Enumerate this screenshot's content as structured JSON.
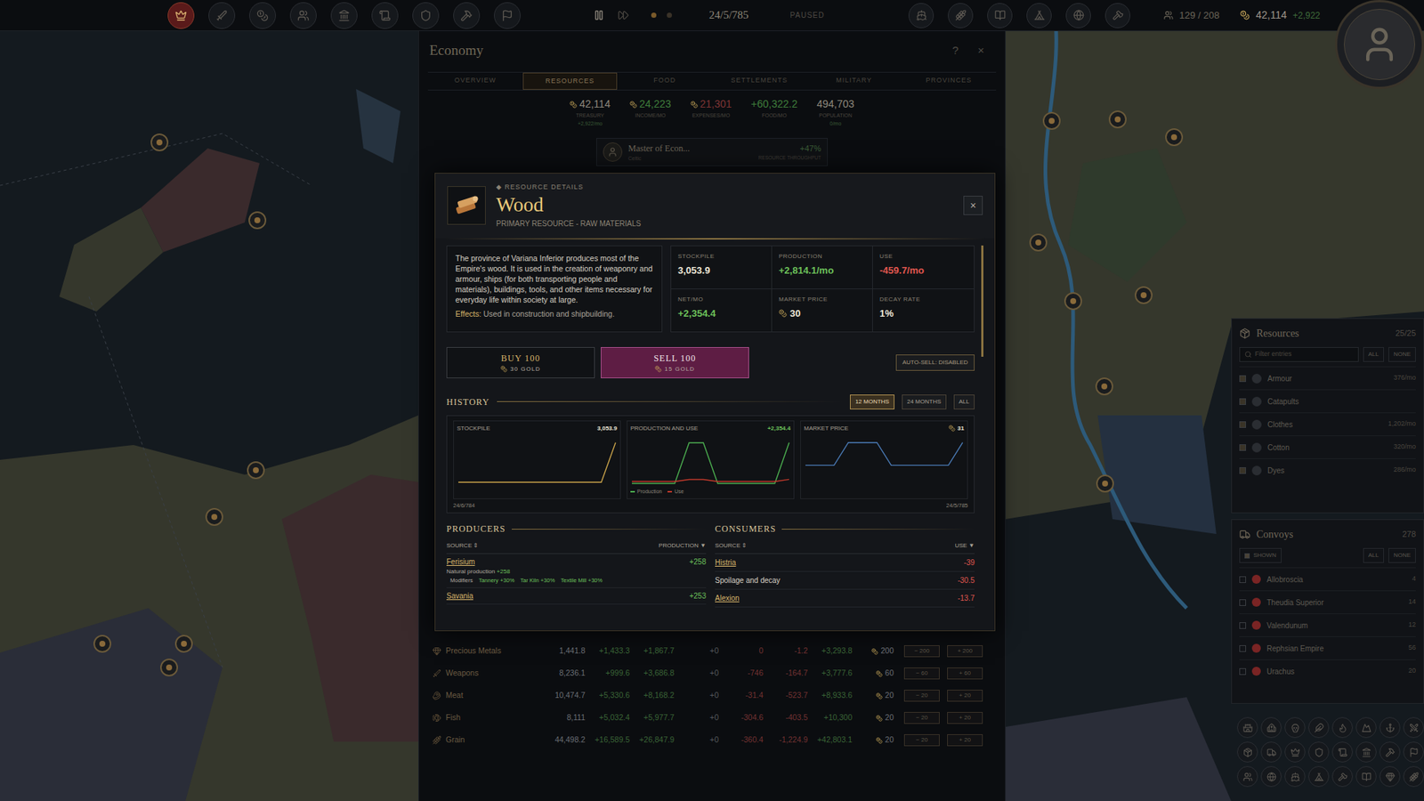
{
  "top_bar": {
    "left_buttons": [
      {
        "selected": true
      },
      {
        "selected": false
      },
      {
        "selected": false
      },
      {
        "selected": false
      },
      {
        "selected": false
      },
      {
        "selected": false
      },
      {
        "selected": false
      },
      {
        "selected": false
      },
      {
        "selected": false
      }
    ],
    "right_buttons": [
      {
        "selected": false
      },
      {
        "selected": false
      },
      {
        "selected": false
      },
      {
        "selected": false
      },
      {
        "selected": false
      },
      {
        "selected": false
      }
    ],
    "paused": true,
    "date": "24/5/785",
    "status": "PAUSED",
    "population": "129 / 208",
    "treasury": "42,114",
    "treasury_change": "+2,922"
  },
  "economy": {
    "title": "Economy",
    "help": "?",
    "close": "×",
    "tabs": [
      {
        "label": "OVERVIEW",
        "selected": false
      },
      {
        "label": "RESOURCES",
        "selected": true
      },
      {
        "label": "FOOD",
        "selected": false
      },
      {
        "label": "SETTLEMENTS",
        "selected": false
      },
      {
        "label": "MILITARY",
        "selected": false
      },
      {
        "label": "PROVINCES",
        "selected": false
      }
    ],
    "stats": [
      {
        "value": "42,114",
        "label": "TREASURY",
        "sub": "+2,922/mo",
        "coin": true,
        "color": "#8d887c"
      },
      {
        "value": "24,223",
        "label": "INCOME/MO",
        "sub": "",
        "coin": true,
        "color": "#3f7d3b"
      },
      {
        "value": "21,301",
        "label": "EXPENSES/MO",
        "sub": "",
        "coin": true,
        "color": "#7d3434"
      },
      {
        "value": "+60,322.2",
        "label": "FOOD/MO",
        "sub": "",
        "coin": false,
        "color": "#3f7d3b"
      },
      {
        "value": "494,703",
        "label": "POPULATION",
        "sub": "0/mo",
        "coin": false,
        "color": "#8d887c"
      }
    ],
    "minister": {
      "name": "Master of Econ...",
      "culture": "Celtic",
      "bonus": "+47%",
      "bonus_label": "RESOURCE THROUGHPUT"
    },
    "rows": [
      {
        "name": "Precious Metals",
        "cells": [
          "1,441.8",
          "+1,433.3",
          "+1,867.7",
          "+0",
          "0",
          "-1.2",
          "+3,293.8",
          "200"
        ],
        "sell": "− 200",
        "buy": "+ 200"
      },
      {
        "name": "Weapons",
        "cells": [
          "8,236.1",
          "+999.6",
          "+3,686.8",
          "+0",
          "-746",
          "-164.7",
          "+3,777.6",
          "60"
        ],
        "sell": "− 60",
        "buy": "+ 60"
      },
      {
        "name": "Meat",
        "cells": [
          "10,474.7",
          "+5,330.6",
          "+8,168.2",
          "+0",
          "-31.4",
          "-523.7",
          "+8,933.6",
          "20"
        ],
        "sell": "− 20",
        "buy": "+ 20"
      },
      {
        "name": "Fish",
        "cells": [
          "8,111",
          "+5,032.4",
          "+5,977.7",
          "+0",
          "-304.6",
          "-403.5",
          "+10,300",
          "20"
        ],
        "sell": "− 20",
        "buy": "+ 20"
      },
      {
        "name": "Grain",
        "cells": [
          "44,498.2",
          "+16,589.5",
          "+26,847.9",
          "+0",
          "-360.4",
          "-1,224.9",
          "+42,803.1",
          "20"
        ],
        "sell": "− 20",
        "buy": "+ 20"
      }
    ]
  },
  "resource": {
    "eyebrow": "◆ RESOURCE DETAILS",
    "name": "Wood",
    "category": "PRIMARY RESOURCE - RAW MATERIALS",
    "close": "×",
    "description": "The province of Variana Inferior produces most of the Empire's wood. It is used in the creation of weaponry and armour, ships (for both transporting people and materials), buildings, tools, and other items necessary for everyday life within society at large.",
    "effects_label": "Effects:",
    "effects": "Used in construction and shipbuilding.",
    "stats": [
      {
        "label": "STOCKPILE",
        "value": "3,053.9",
        "color": "#ece6d8",
        "coin": false
      },
      {
        "label": "PRODUCTION",
        "value": "+2,814.1/mo",
        "color": "#6cc05a",
        "coin": false
      },
      {
        "label": "USE",
        "value": "-459.7/mo",
        "color": "#e0574f",
        "coin": false
      },
      {
        "label": "NET/MO",
        "value": "+2,354.4",
        "color": "#6cc05a",
        "coin": false
      },
      {
        "label": "MARKET PRICE",
        "value": "30",
        "color": "#ece6d8",
        "coin": true
      },
      {
        "label": "DECAY RATE",
        "value": "1%",
        "color": "#ece6d8",
        "coin": false
      }
    ],
    "trade": {
      "buy": {
        "label": "BUY 100",
        "price": "30 GOLD",
        "selected": false
      },
      "sell": {
        "label": "SELL 100",
        "price": "15 GOLD",
        "selected": true
      },
      "auto_sell": {
        "label": "AUTO-SELL: DISABLED",
        "on": false
      }
    },
    "history": {
      "title": "HISTORY",
      "ranges": [
        {
          "label": "12 MONTHS",
          "selected": true
        },
        {
          "label": "24 MONTHS",
          "selected": false
        },
        {
          "label": "ALL",
          "selected": false
        }
      ],
      "start_date": "24/6/784",
      "end_date": "24/5/785",
      "charts": [
        {
          "title": "STOCKPILE",
          "reading": "3,053.9",
          "reading_color": "#ece6d8",
          "coin": false,
          "series": [
            {
              "name": "",
              "color": "#c9a34a",
              "values": [
                300,
                300,
                300,
                300,
                300,
                300,
                300,
                300,
                300,
                300,
                300,
                3053.9
              ]
            }
          ]
        },
        {
          "title": "PRODUCTION AND USE",
          "reading": "+2,354.4",
          "reading_color": "#6cc05a",
          "coin": false,
          "series": [
            {
              "name": "Production",
              "color": "#4caf50",
              "values": [
                200,
                200,
                200,
                200,
                2800,
                2800,
                200,
                200,
                200,
                200,
                200,
                2814.1
              ]
            },
            {
              "name": "Use",
              "color": "#c0392b",
              "values": [
                320,
                320,
                320,
                320,
                450,
                450,
                320,
                320,
                320,
                320,
                320,
                459.7
              ]
            }
          ]
        },
        {
          "title": "MARKET PRICE",
          "reading": "31",
          "reading_color": "#ece6d8",
          "coin": true,
          "series": [
            {
              "name": "",
              "color": "#4a7ab5",
              "values": [
                15,
                15,
                15,
                31,
                31,
                31,
                15,
                15,
                15,
                15,
                15,
                31
              ]
            }
          ]
        }
      ]
    },
    "producers": {
      "title": "PRODUCERS",
      "source_col": "SOURCE",
      "source_sort": "⇕",
      "value_col": "PRODUCTION",
      "value_sort": "▼",
      "rows": [
        {
          "name": "Ferisium",
          "value": "+258",
          "detail_label": "Natural production",
          "detail_value": "+258",
          "modifiers_label": "Modifiers",
          "modifiers": [
            "Tannery +30%",
            "Tar Kiln +30%",
            "Textile Mill +30%"
          ]
        },
        {
          "name": "Savania",
          "value": "+253",
          "detail_label": "",
          "detail_value": "",
          "modifiers_label": "",
          "modifiers": []
        }
      ]
    },
    "consumers": {
      "title": "CONSUMERS",
      "source_col": "SOURCE",
      "source_sort": "⇕",
      "value_col": "USE",
      "value_sort": "▼",
      "rows": [
        {
          "name": "Histria",
          "value": "-39",
          "link": true
        },
        {
          "name": "Spoilage and decay",
          "value": "-30.5",
          "link": false
        },
        {
          "name": "Alexion",
          "value": "-13.7",
          "link": true
        }
      ]
    }
  },
  "resources_panel": {
    "title": "Resources",
    "count": "25/25",
    "filter_placeholder": "Filter entries",
    "all": "ALL",
    "none": "NONE",
    "items": [
      {
        "name": "Armour",
        "rate": "376/mo",
        "checked": true
      },
      {
        "name": "Catapults",
        "rate": "",
        "checked": true
      },
      {
        "name": "Clothes",
        "rate": "1,202/mo",
        "checked": true
      },
      {
        "name": "Cotton",
        "rate": "320/mo",
        "checked": true
      },
      {
        "name": "Dyes",
        "rate": "286/mo",
        "checked": true
      }
    ]
  },
  "convoys_panel": {
    "title": "Convoys",
    "count": "278",
    "shown": "SHOWN",
    "shown_on": true,
    "all": "ALL",
    "none": "NONE",
    "items": [
      {
        "name": "Allobroscia",
        "count": "4",
        "color": "#7a2424"
      },
      {
        "name": "Theudia Superior",
        "count": "14",
        "color": "#7a2424"
      },
      {
        "name": "Valendunum",
        "count": "12",
        "color": "#7a2424"
      },
      {
        "name": "Rephsian Empire",
        "count": "56",
        "color": "#7a2424"
      },
      {
        "name": "Urachus",
        "count": "20",
        "color": "#7a2424"
      }
    ]
  }
}
